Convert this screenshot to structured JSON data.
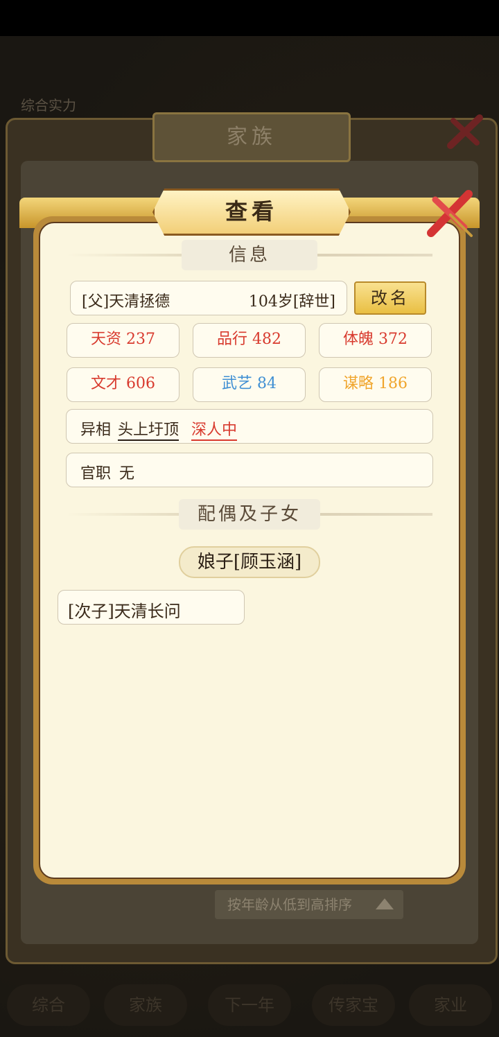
{
  "background": {
    "header_left": "综合实力",
    "back_window_title": "家族",
    "sort_button": "按年龄从低到高排序",
    "bottom_tabs": [
      "综合",
      "家族",
      "下一年",
      "传家宝",
      "家业"
    ]
  },
  "dialog": {
    "title": "查看",
    "info_section": "信息",
    "member_name": "[父]天清拯德",
    "member_age": "104岁[辞世]",
    "rename_button": "改名",
    "stats": [
      {
        "label": "天资",
        "value": "237",
        "color": "#d83a2e"
      },
      {
        "label": "品行",
        "value": "482",
        "color": "#d83a2e"
      },
      {
        "label": "体魄",
        "value": "372",
        "color": "#d83a2e"
      },
      {
        "label": "文才",
        "value": "606",
        "color": "#d83a2e"
      },
      {
        "label": "武艺",
        "value": "84",
        "color": "#3f8fd3"
      },
      {
        "label": "谋略",
        "value": "186",
        "color": "#f0a52c"
      }
    ],
    "traits_label": "异相",
    "trait_1": "头上圩顶",
    "trait_2": "深人中",
    "office_label": "官职",
    "office_value": "无",
    "family_section": "配偶及子女",
    "spouse": "娘子[顾玉涵]",
    "children": [
      "[次子]天清长问"
    ]
  }
}
